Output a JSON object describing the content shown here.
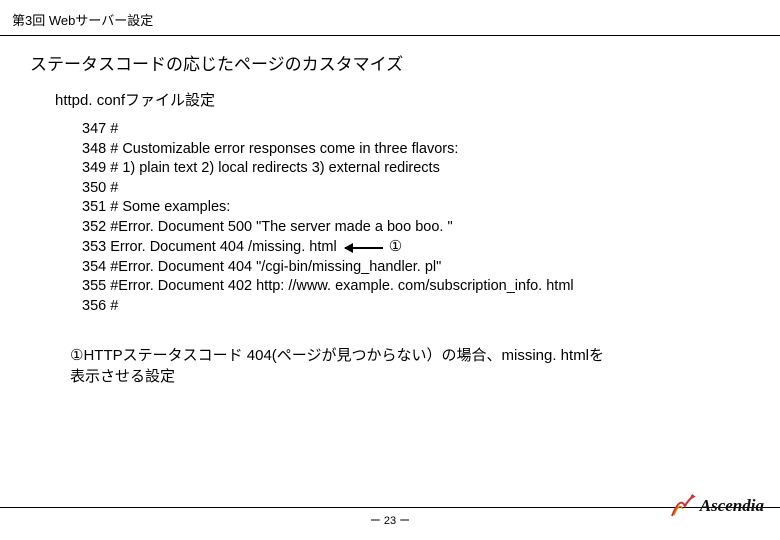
{
  "header": "第3回 Webサーバー設定",
  "section_title": "ステータスコードの応じたページのカスタマイズ",
  "subsection": "httpd. confファイル設定",
  "code": {
    "l347": "347 #",
    "l348": "348 # Customizable error responses come in three flavors:",
    "l349": "349 # 1) plain text 2) local redirects 3) external redirects",
    "l350": "350 #",
    "l351": "351 # Some examples:",
    "l352": "352 #Error. Document 500 \"The server made a boo boo. \"",
    "l353": "353 Error. Document 404 /missing. html",
    "l353_marker": "①",
    "l354": "354 #Error. Document 404 \"/cgi-bin/missing_handler. pl\"",
    "l355": "355 #Error. Document 402 http: //www. example. com/subscription_info. html",
    "l356": "356 #"
  },
  "note_line1": "①HTTPステータスコード 404(ページが見つからない）の場合、missing. htmlを",
  "note_line2": "表示させる設定",
  "page_number": "ー 23 ー",
  "logo_text": "Ascendia"
}
